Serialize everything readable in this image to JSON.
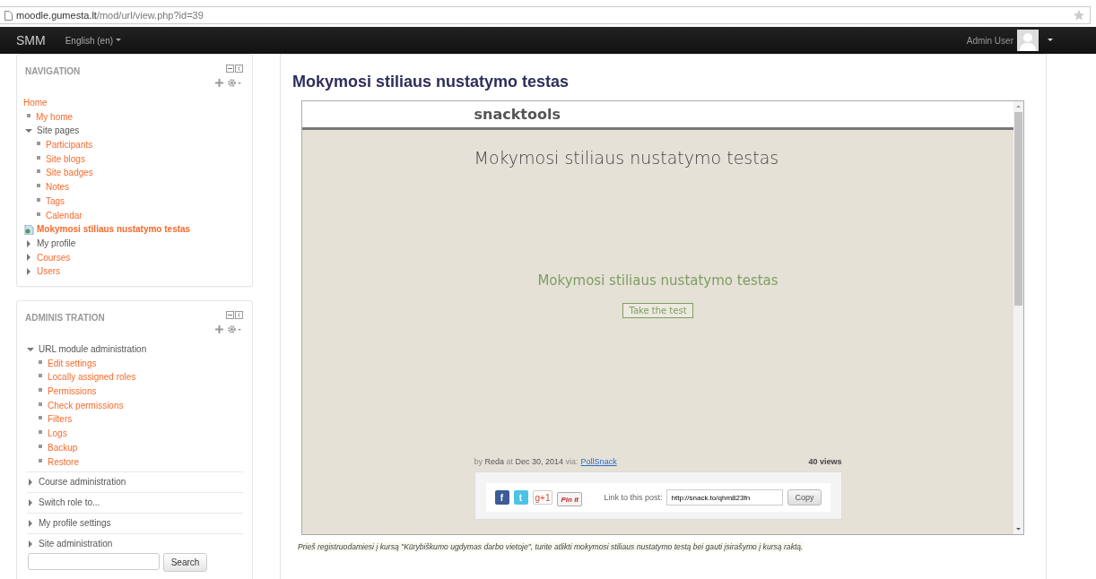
{
  "address_bar": {
    "host": "moodle.gumesta.lt",
    "path": "/mod/url/view.php?id=39"
  },
  "navbar": {
    "brand": "SMM",
    "language": "English (en)",
    "user": "Admin User"
  },
  "navigation": {
    "title": "NAVIGATION",
    "items": [
      {
        "label": "Home",
        "kind": "root",
        "link": true
      },
      {
        "label": "My home",
        "kind": "leaf",
        "link": true
      },
      {
        "label": "Site pages",
        "kind": "branch",
        "link": false,
        "expanded": true,
        "children": [
          {
            "label": "Participants",
            "kind": "leaf",
            "link": true
          },
          {
            "label": "Site blogs",
            "kind": "leaf",
            "link": true
          },
          {
            "label": "Site badges",
            "kind": "leaf",
            "link": true
          },
          {
            "label": "Notes",
            "kind": "leaf",
            "link": true
          },
          {
            "label": "Tags",
            "kind": "leaf",
            "link": true
          },
          {
            "label": "Calendar",
            "kind": "leaf",
            "link": true
          }
        ]
      },
      {
        "label": "Mokymosi stiliaus nustatymo testas",
        "kind": "page",
        "link": true,
        "current": true
      },
      {
        "label": "My profile",
        "kind": "branch",
        "link": false,
        "expanded": false
      },
      {
        "label": "Courses",
        "kind": "branch",
        "link": true,
        "expanded": false
      },
      {
        "label": "Users",
        "kind": "branch",
        "link": true,
        "expanded": false
      }
    ]
  },
  "administration": {
    "title": "ADMINIS TRATION",
    "items": [
      {
        "label": "URL module administration",
        "kind": "branch",
        "link": false,
        "expanded": true,
        "children": [
          {
            "label": "Edit settings",
            "kind": "leaf",
            "link": true
          },
          {
            "label": "Locally assigned roles",
            "kind": "leaf",
            "link": true
          },
          {
            "label": "Permissions",
            "kind": "leaf",
            "link": true
          },
          {
            "label": "Check permissions",
            "kind": "leaf",
            "link": true
          },
          {
            "label": "Filters",
            "kind": "leaf",
            "link": true
          },
          {
            "label": "Logs",
            "kind": "leaf",
            "link": true
          },
          {
            "label": "Backup",
            "kind": "leaf",
            "link": true
          },
          {
            "label": "Restore",
            "kind": "leaf",
            "link": true
          }
        ]
      },
      {
        "label": "Course administration",
        "kind": "branch",
        "link": false,
        "expanded": false
      },
      {
        "label": "Switch role to...",
        "kind": "branch",
        "link": false,
        "expanded": false
      },
      {
        "label": "My profile settings",
        "kind": "branch",
        "link": false,
        "expanded": false
      },
      {
        "label": "Site administration",
        "kind": "branch",
        "link": false,
        "expanded": false
      }
    ],
    "search_button": "Search"
  },
  "main": {
    "heading": "Mokymosi stiliaus nustatymo testas",
    "embed": {
      "logo": "snacktools",
      "title": "Mokymosi stiliaus nustatymo testas",
      "quiz_title": "Mokymosi stiliaus nustatymo testas",
      "start_button": "Take the test",
      "byline": {
        "by": "by",
        "author": "Reda",
        "at": "at",
        "date": "Dec 30, 2014",
        "via": "via:",
        "source": "PollSnack",
        "views": "40 views"
      },
      "share_buttons": [
        {
          "kind": "facebook",
          "label": "f"
        },
        {
          "kind": "twitter",
          "label": "t"
        },
        {
          "kind": "gplus",
          "label": "g+1"
        },
        {
          "kind": "pinterest",
          "label": "Pin it"
        }
      ],
      "link_label": "Link to this post:",
      "link_value": "http://snack.to/qhm823fn",
      "copy_button": "Copy"
    },
    "note": "Prieš registruodamiesi į kursą \"Kūrybiškumo ugdymas darbo vietoje\", turite atlikti mokymosi stiliaus nustatymo testą bei gauti įsirašymo į kursą raktą."
  }
}
